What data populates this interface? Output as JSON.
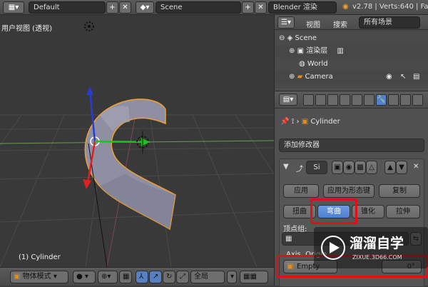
{
  "topbar": {
    "layout_name": "Default",
    "scene_name": "Scene",
    "render_engine": "Blender 渲染",
    "version_stats": "v2.78 | Verts:640 | Fa"
  },
  "viewport": {
    "view_label": "用户视图 (透视)",
    "object_label": "(1) Cylinder"
  },
  "bottombar": {
    "mode": "物体模式",
    "pivot": "全局"
  },
  "outliner": {
    "view_menu": "视图",
    "search_menu": "搜索",
    "filter": "所有场景",
    "rows": [
      {
        "label": "Scene"
      },
      {
        "label": "渲染层"
      },
      {
        "label": "World"
      },
      {
        "label": "Camera"
      }
    ]
  },
  "properties": {
    "object_name": "Cylinder",
    "add_modifier": "添加修改器",
    "modifier_name": "Si",
    "apply": "应用",
    "apply_shape": "应用为形态键",
    "copy": "复制",
    "modes": [
      "扭曲",
      "弯曲",
      "锥化",
      "拉伸"
    ],
    "active_mode_index": 1,
    "vertex_group_label": "顶点组:",
    "axis_origin_label": "Axis, Origin",
    "origin_object": "Empty",
    "angle_value": "0°"
  },
  "watermark": {
    "brand": "溜溜自学",
    "url": "ZIXUE.3D66.COM"
  },
  "colors": {
    "highlight": "#e0101a",
    "selected": "#5680c2",
    "mesh": "#8d8da0",
    "outline": "#f0a030"
  }
}
